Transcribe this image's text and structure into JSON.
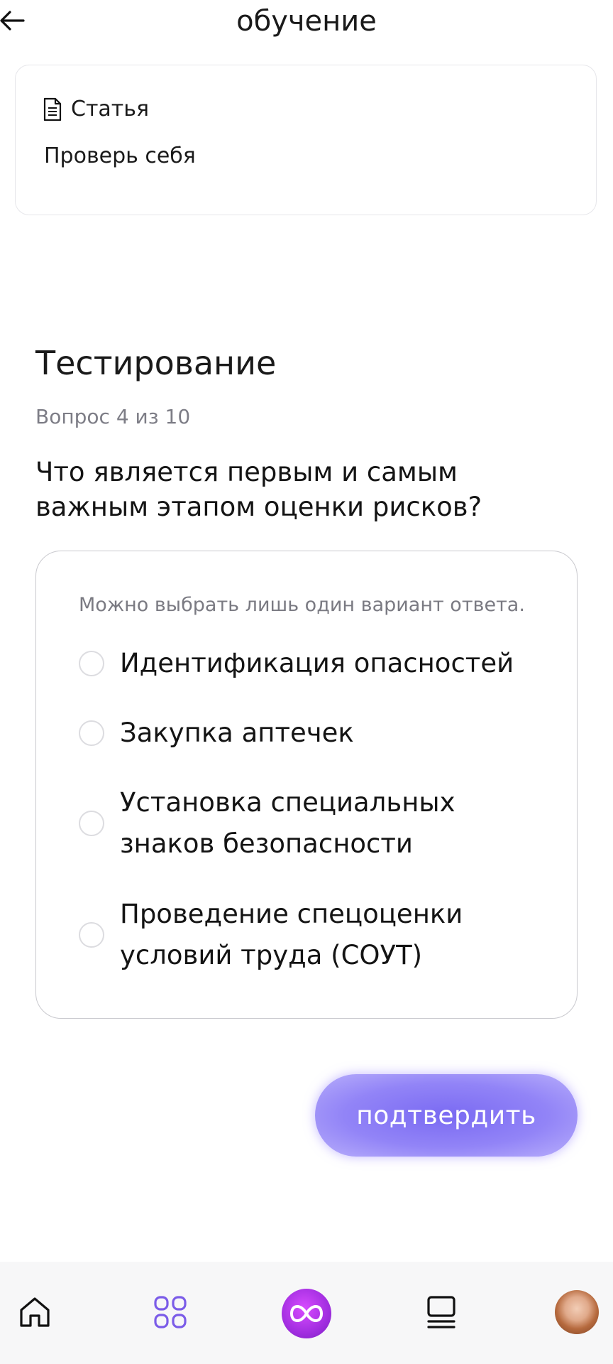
{
  "header": {
    "title": "обучение",
    "back_icon": "arrow-left-icon"
  },
  "material_card": {
    "type_icon": "document-icon",
    "type_label": "Статья",
    "title": "Проверь себя"
  },
  "test": {
    "title": "Тестирование",
    "counter": "Вопрос 4 из 10",
    "question": "Что является первым и самым важным этапом оценки рисков?",
    "hint": "Можно выбрать лишь один вариант ответа.",
    "options": [
      {
        "label": "Идентификация опасностей",
        "selected": false
      },
      {
        "label": "Закупка аптечек",
        "selected": false
      },
      {
        "label": "Установка специальных знаков безопасности",
        "selected": false
      },
      {
        "label": "Проведение спецоценки условий труда (СОУТ)",
        "selected": false
      }
    ],
    "confirm_label": "подтвердить"
  },
  "bottom_nav": {
    "items": [
      {
        "icon": "home-icon",
        "active": false
      },
      {
        "icon": "grid-icon",
        "active": true
      },
      {
        "icon": "infinity-icon",
        "active": false
      },
      {
        "icon": "list-icon",
        "active": false
      },
      {
        "icon": "avatar",
        "active": false
      }
    ]
  },
  "colors": {
    "accent": "#8a7af5",
    "nav_active": "#7b5ce8",
    "center_button": "#c13cf0"
  }
}
